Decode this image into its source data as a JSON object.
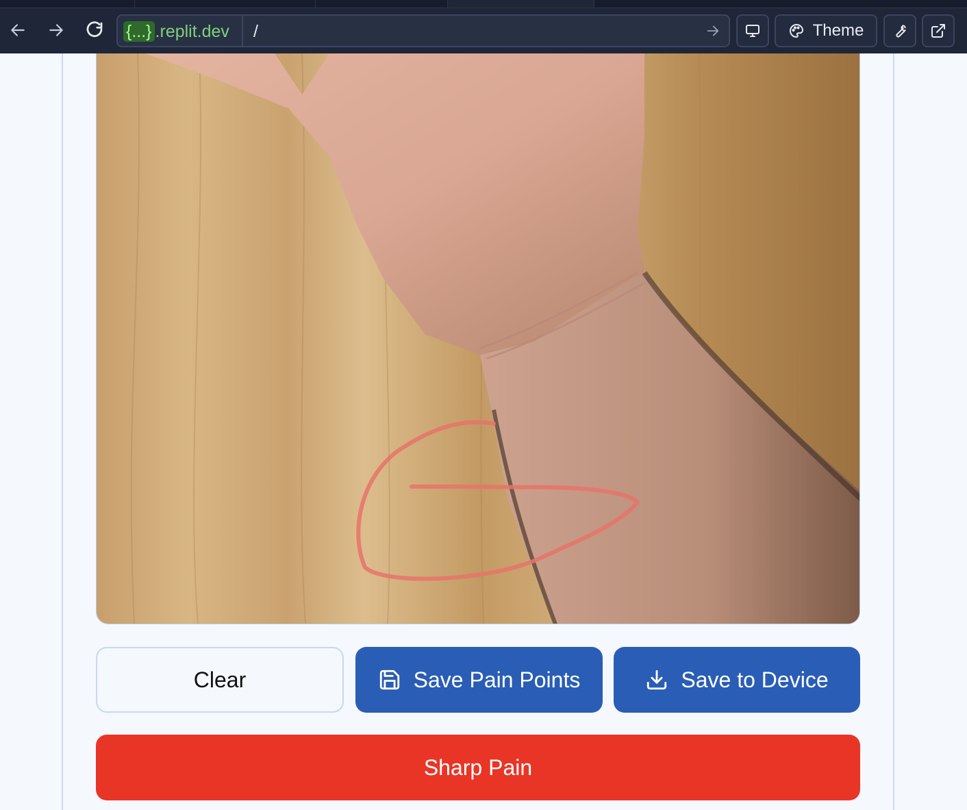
{
  "browser": {
    "url_chip": "{...}",
    "url_host": ".replit.dev",
    "url_path": "/",
    "theme_label": "Theme",
    "icons": [
      "back-arrow-icon",
      "forward-arrow-icon",
      "reload-icon",
      "go-arrow-icon",
      "monitor-icon",
      "palette-icon",
      "wrench-icon",
      "external-link-icon"
    ]
  },
  "canvas": {
    "image_description_icon": "forearm-photo",
    "annotation_color": "#e8736a"
  },
  "actions": {
    "clear_label": "Clear",
    "save_points_label": "Save Pain Points",
    "save_device_label": "Save to Device",
    "sharp_pain_label": "Sharp Pain"
  },
  "colors": {
    "primary": "#2a5db5",
    "danger": "#e93526",
    "chrome_bg": "#1f2638"
  }
}
